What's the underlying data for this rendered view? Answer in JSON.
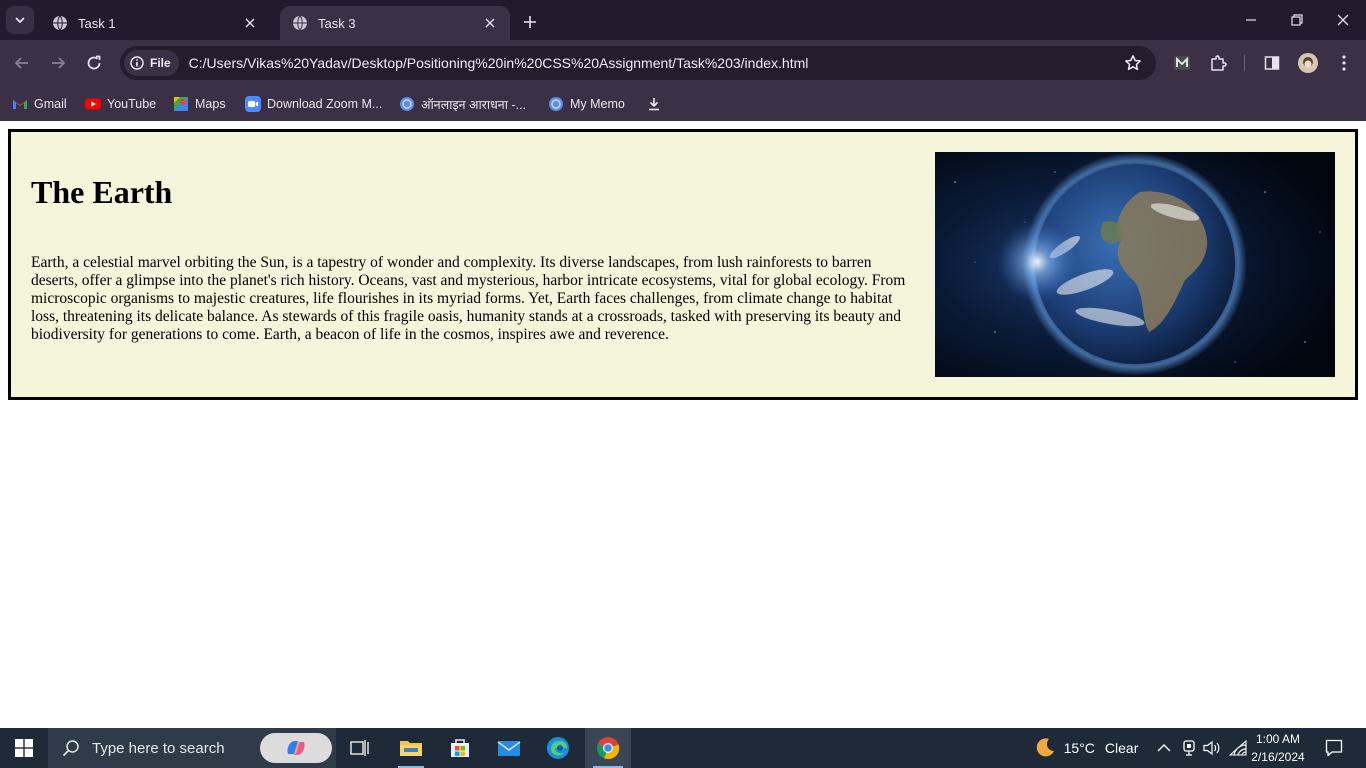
{
  "browser": {
    "tabs": [
      {
        "title": "Task 1",
        "active": false
      },
      {
        "title": "Task 3",
        "active": true
      }
    ],
    "address": {
      "scheme_chip": "File",
      "url": "C:/Users/Vikas%20Yadav/Desktop/Positioning%20in%20CSS%20Assignment/Task%203/index.html"
    },
    "bookmarks": [
      {
        "label": "Gmail",
        "icon": "gmail-icon"
      },
      {
        "label": "YouTube",
        "icon": "youtube-icon"
      },
      {
        "label": "Maps",
        "icon": "maps-icon"
      },
      {
        "label": "Download Zoom M...",
        "icon": "zoom-icon"
      },
      {
        "label": "ऑनलाइन आराधना -...",
        "icon": "globe-icon"
      },
      {
        "label": "My Memo",
        "icon": "globe-icon"
      }
    ]
  },
  "page": {
    "heading": "The Earth",
    "paragraph": "Earth, a celestial marvel orbiting the Sun, is a tapestry of wonder and complexity. Its diverse landscapes, from lush rainforests to barren deserts, offer a glimpse into the planet's rich history. Oceans, vast and mysterious, harbor intricate ecosystems, vital for global ecology. From microscopic organisms to majestic creatures, life flourishes in its myriad forms. Yet, Earth faces challenges, from climate change to habitat loss, threatening its delicate balance. As stewards of this fragile oasis, humanity stands at a crossroads, tasked with preserving its beauty and biodiversity for generations to come. Earth, a beacon of life in the cosmos, inspires awe and reverence.",
    "image": "earth-from-space",
    "card_background": "#f5f5dc"
  },
  "taskbar": {
    "search_placeholder": "Type here to search",
    "weather": {
      "temperature": "15°C",
      "condition": "Clear"
    },
    "time": "1:00 AM",
    "date": "2/16/2024"
  },
  "colors": {
    "chrome_dark": "#241a2e",
    "chrome": "#3b3046",
    "taskbar": "#1e2a38"
  }
}
